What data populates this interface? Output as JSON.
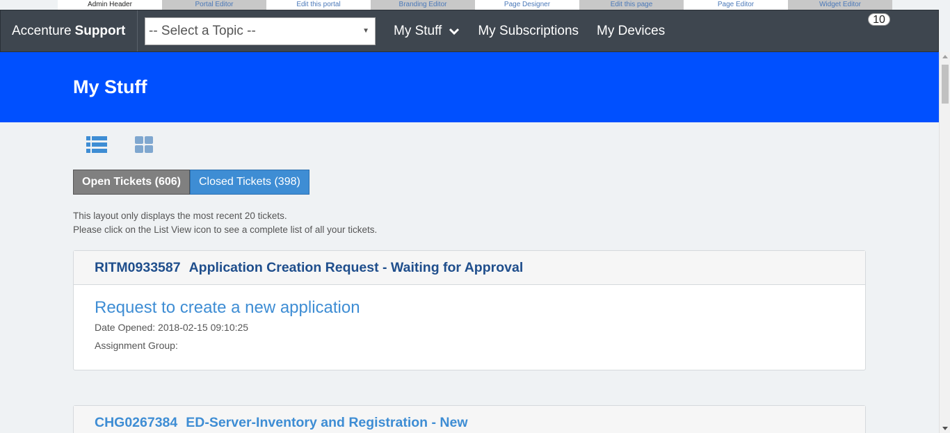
{
  "admin_bar": {
    "tabs": [
      "Admin Header",
      "Portal Editor",
      "Edit this portal",
      "Branding Editor",
      "Page Designer",
      "Edit this page",
      "Page Editor",
      "Widget Editor"
    ]
  },
  "nav": {
    "brand_regular": "Accenture",
    "brand_bold": "Support",
    "topic_select_value": "-- Select a Topic --",
    "items": [
      "My Stuff",
      "My Subscriptions",
      "My Devices"
    ],
    "notification_count": "10"
  },
  "hero": {
    "title": "My Stuff"
  },
  "views": {
    "list_icon": "list-view-icon",
    "grid_icon": "grid-view-icon"
  },
  "ticket_tabs": {
    "open": "Open Tickets (606)",
    "closed": "Closed Tickets (398)"
  },
  "info": {
    "line1": "This layout only displays the most recent 20 tickets.",
    "line2": "Please click on the List View icon to see a complete list of all your tickets."
  },
  "tickets": [
    {
      "number": "RITM0933587",
      "heading": "Application Creation Request - Waiting for Approval",
      "title": "Request to create a new application",
      "date_opened": "Date Opened: 2018-02-15 09:10:25",
      "assignment_group": "Assignment Group:"
    },
    {
      "number": "CHG0267384",
      "heading": "ED-Server-Inventory and Registration - New"
    }
  ],
  "colors": {
    "nav_bg": "#3e464f",
    "hero_bg": "#0050ff",
    "accent": "#3e8dd4"
  }
}
